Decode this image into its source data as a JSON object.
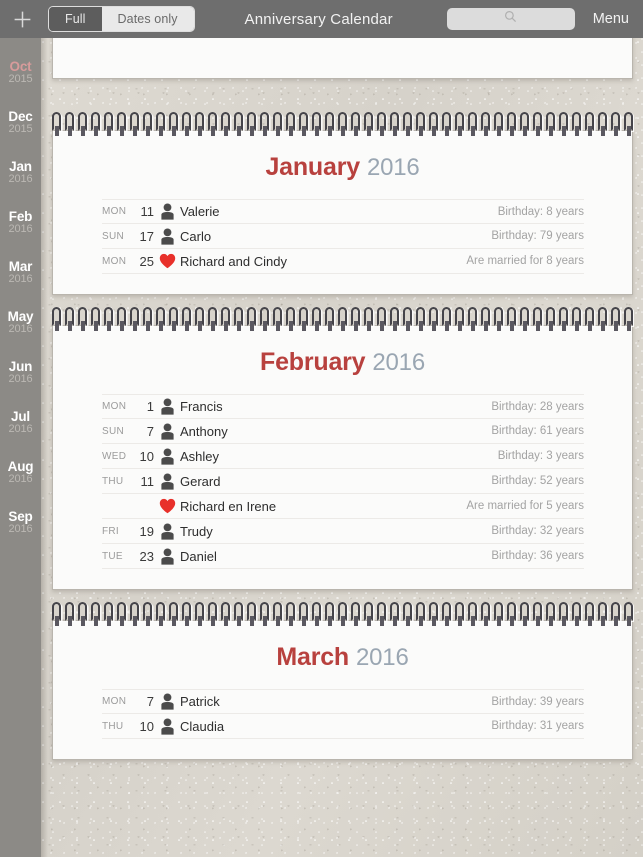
{
  "toolbar": {
    "add_label": "+",
    "add_icon": "plus-icon",
    "segments": [
      {
        "label": "Full",
        "selected": true
      },
      {
        "label": "Dates only",
        "selected": false
      }
    ],
    "title": "Anniversary Calendar",
    "search": {
      "value": "",
      "placeholder": "",
      "icon": "search-icon"
    },
    "menu_label": "Menu"
  },
  "sidebar": {
    "items": [
      {
        "month": "Oct",
        "year": "2015",
        "accent": true
      },
      {
        "month": "Dec",
        "year": "2015",
        "accent": false
      },
      {
        "month": "Jan",
        "year": "2016",
        "accent": false
      },
      {
        "month": "Feb",
        "year": "2016",
        "accent": false
      },
      {
        "month": "Mar",
        "year": "2016",
        "accent": false
      },
      {
        "month": "May",
        "year": "2016",
        "accent": false
      },
      {
        "month": "Jun",
        "year": "2016",
        "accent": false
      },
      {
        "month": "Jul",
        "year": "2016",
        "accent": false
      },
      {
        "month": "Aug",
        "year": "2016",
        "accent": false
      },
      {
        "month": "Sep",
        "year": "2016",
        "accent": false
      }
    ]
  },
  "colors": {
    "month_name": "#b8413e",
    "month_year": "#9aa6b2",
    "accent_sidebar": "#d79b9b",
    "toolbar_bg": "#6e6e6e",
    "sidebar_bg": "#8c8a86",
    "paper_bg": "#d8d4cc",
    "card_bg": "#fbfbfa",
    "heart": "#e8302a",
    "person": "#4b4b4b"
  },
  "months": [
    {
      "name": "January",
      "year": "2016",
      "rows": [
        {
          "dow": "MON",
          "day": "11",
          "icon": "person-icon",
          "name": "Valerie",
          "note": "Birthday: 8 years"
        },
        {
          "dow": "SUN",
          "day": "17",
          "icon": "person-icon",
          "name": "Carlo",
          "note": "Birthday: 79 years"
        },
        {
          "dow": "MON",
          "day": "25",
          "icon": "heart-icon",
          "name": "Richard and Cindy",
          "note": "Are married for 8 years"
        }
      ]
    },
    {
      "name": "February",
      "year": "2016",
      "rows": [
        {
          "dow": "MON",
          "day": "1",
          "icon": "person-icon",
          "name": "Francis",
          "note": "Birthday: 28 years"
        },
        {
          "dow": "SUN",
          "day": "7",
          "icon": "person-icon",
          "name": "Anthony",
          "note": "Birthday: 61 years"
        },
        {
          "dow": "WED",
          "day": "10",
          "icon": "person-icon",
          "name": "Ashley",
          "note": "Birthday: 3 years"
        },
        {
          "dow": "THU",
          "day": "11",
          "icon": "person-icon",
          "name": "Gerard",
          "note": "Birthday: 52 years"
        },
        {
          "dow": "",
          "day": "",
          "icon": "heart-icon",
          "name": "Richard en Irene",
          "note": "Are married for 5 years"
        },
        {
          "dow": "FRI",
          "day": "19",
          "icon": "person-icon",
          "name": "Trudy",
          "note": "Birthday: 32 years"
        },
        {
          "dow": "TUE",
          "day": "23",
          "icon": "person-icon",
          "name": "Daniel",
          "note": "Birthday: 36 years"
        }
      ]
    },
    {
      "name": "March",
      "year": "2016",
      "rows": [
        {
          "dow": "MON",
          "day": "7",
          "icon": "person-icon",
          "name": "Patrick",
          "note": "Birthday: 39 years"
        },
        {
          "dow": "THU",
          "day": "10",
          "icon": "person-icon",
          "name": "Claudia",
          "note": "Birthday: 31 years"
        }
      ]
    }
  ]
}
